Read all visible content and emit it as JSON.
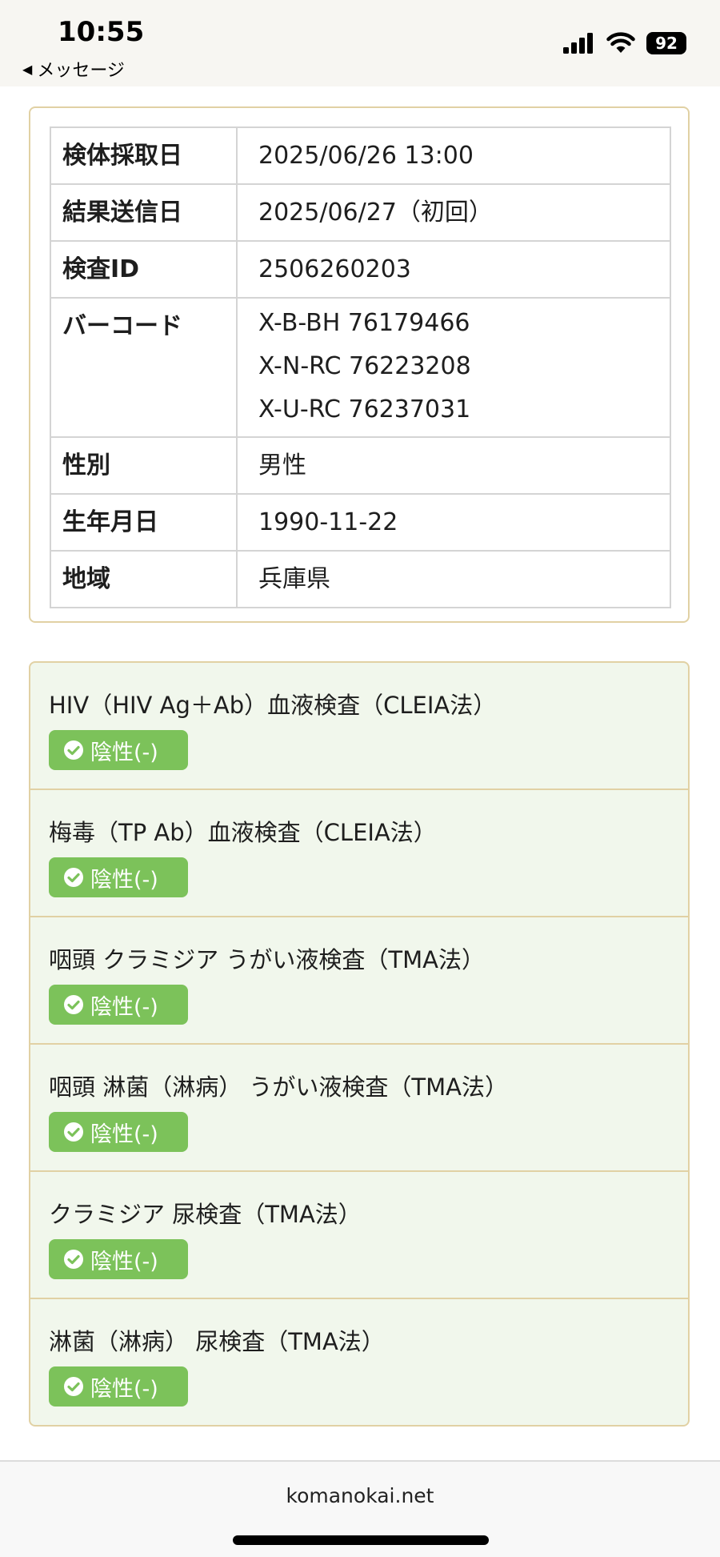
{
  "status_bar": {
    "time": "10:55",
    "back_label": "メッセージ",
    "battery": "92"
  },
  "info_table": [
    {
      "label": "検体採取日",
      "value": "2025/06/26 13:00"
    },
    {
      "label": "結果送信日",
      "value": "2025/06/27（初回）"
    },
    {
      "label": "検査ID",
      "value": "2506260203"
    },
    {
      "label": "バーコード",
      "values": [
        "X-B-BH 76179466",
        "X-N-RC 76223208",
        "X-U-RC 76237031"
      ]
    },
    {
      "label": "性別",
      "value": "男性"
    },
    {
      "label": "生年月日",
      "value": "1990-11-22"
    },
    {
      "label": "地域",
      "value": "兵庫県"
    }
  ],
  "results": [
    {
      "name": "HIV（HIV Ag＋Ab）血液検査（CLEIA法）",
      "result": "陰性(-)"
    },
    {
      "name": "梅毒（TP Ab）血液検査（CLEIA法）",
      "result": "陰性(-)"
    },
    {
      "name": "咽頭 クラミジア うがい液検査（TMA法）",
      "result": "陰性(-)"
    },
    {
      "name": "咽頭 淋菌（淋病） うがい液検査（TMA法）",
      "result": "陰性(-)"
    },
    {
      "name": "クラミジア 尿検査（TMA法）",
      "result": "陰性(-)"
    },
    {
      "name": "淋菌（淋病） 尿検査（TMA法）",
      "result": "陰性(-)"
    }
  ],
  "footer": {
    "domain": "komanokai.net"
  },
  "colors": {
    "card_border": "#e1d1a4",
    "results_bg": "#f1f7ec",
    "badge_green": "#7cc25a"
  },
  "icons": [
    "back-arrow-icon",
    "signal-icon",
    "wifi-icon",
    "battery-icon",
    "check-circle-icon"
  ]
}
